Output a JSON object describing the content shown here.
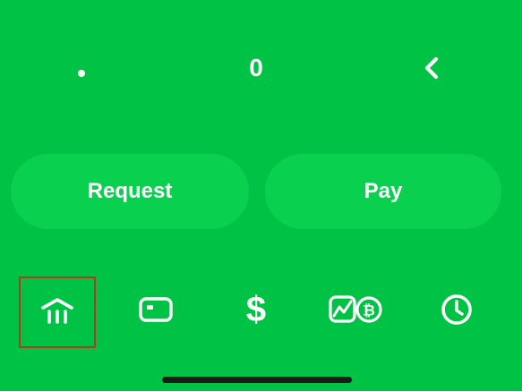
{
  "keypad": {
    "dot_key": "•",
    "zero_key": "0",
    "backspace_key": "‹"
  },
  "actions": {
    "request_label": "Request",
    "pay_label": "Pay"
  },
  "tabbar": {
    "items": [
      {
        "icon": "bank-icon",
        "selected": true
      },
      {
        "icon": "card-icon"
      },
      {
        "icon": "dollar-icon"
      },
      {
        "icon": "investing-bitcoin-icon"
      },
      {
        "icon": "clock-icon"
      }
    ],
    "payments_glyph": "$"
  },
  "colors": {
    "background": "#00c244",
    "button_fill": "#0ad04f",
    "highlight_box": "#b33a1a"
  }
}
